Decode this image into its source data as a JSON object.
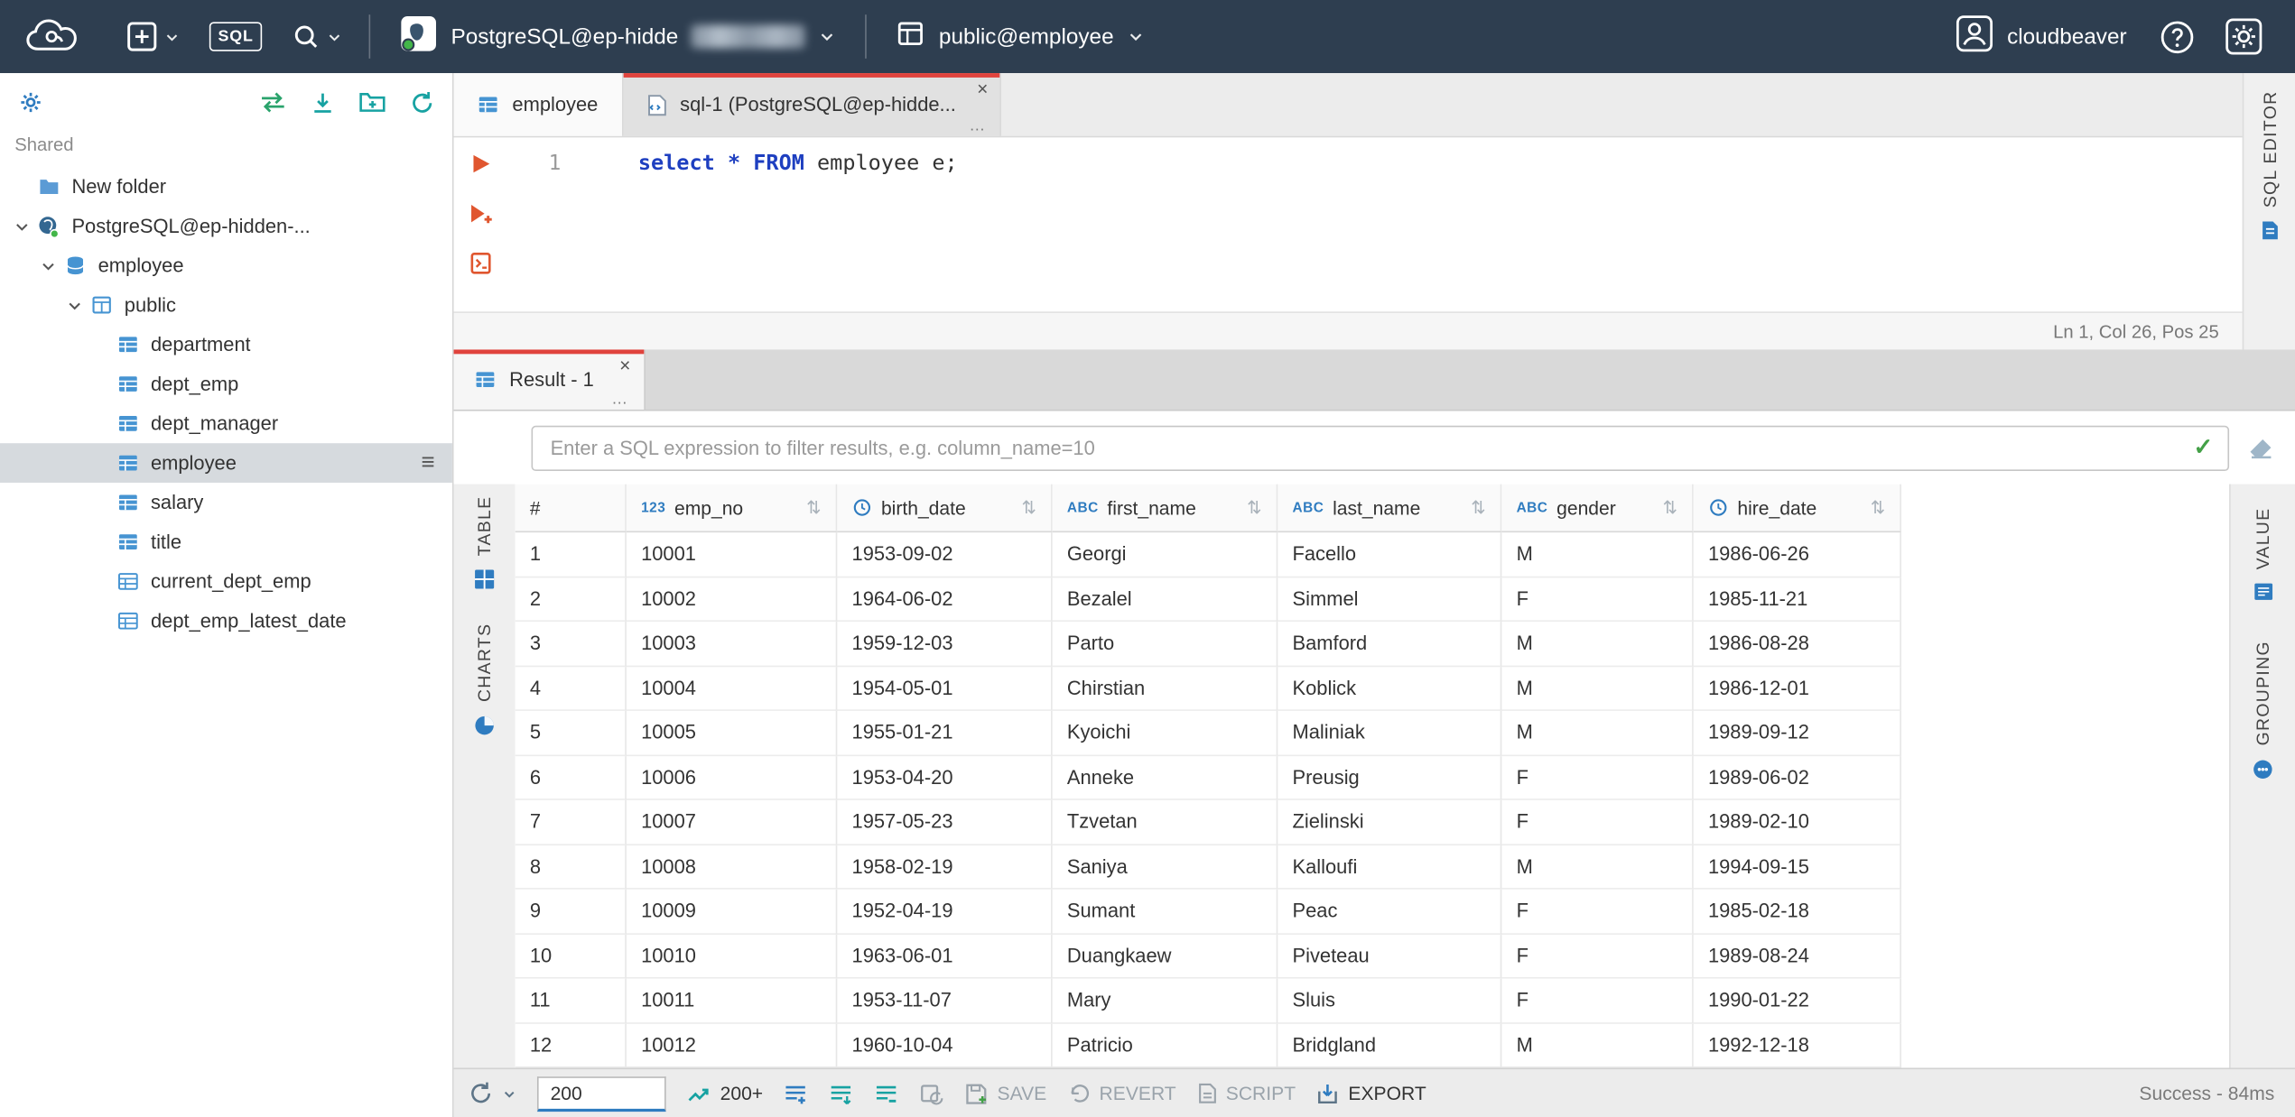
{
  "topbar": {
    "sql_badge": "SQL",
    "connection_label": "PostgreSQL@ep-hidde",
    "schema_label": "public@employee",
    "user_label": "cloudbeaver"
  },
  "sidebar": {
    "section_label": "Shared",
    "items": [
      {
        "label": "New folder",
        "icon": "folder",
        "depth": 0,
        "chevron": null
      },
      {
        "label": "PostgreSQL@ep-hidden-...",
        "icon": "postgres",
        "depth": 0,
        "chevron": "down"
      },
      {
        "label": "employee",
        "icon": "database",
        "depth": 1,
        "chevron": "down"
      },
      {
        "label": "public",
        "icon": "schema",
        "depth": 2,
        "chevron": "down"
      },
      {
        "label": "department",
        "icon": "table",
        "depth": 3,
        "chevron": null
      },
      {
        "label": "dept_emp",
        "icon": "table",
        "depth": 3,
        "chevron": null
      },
      {
        "label": "dept_manager",
        "icon": "table",
        "depth": 3,
        "chevron": null
      },
      {
        "label": "employee",
        "icon": "table",
        "depth": 3,
        "chevron": null,
        "selected": true
      },
      {
        "label": "salary",
        "icon": "table",
        "depth": 3,
        "chevron": null
      },
      {
        "label": "title",
        "icon": "table",
        "depth": 3,
        "chevron": null
      },
      {
        "label": "current_dept_emp",
        "icon": "view",
        "depth": 3,
        "chevron": null
      },
      {
        "label": "dept_emp_latest_date",
        "icon": "view",
        "depth": 3,
        "chevron": null
      }
    ]
  },
  "editor": {
    "tabs": [
      {
        "label": "employee"
      },
      {
        "label": "sql-1 (PostgreSQL@ep-hidde..."
      }
    ],
    "line_number": "1",
    "tokens": [
      {
        "text": "select",
        "type": "keyword"
      },
      {
        "text": " ",
        "type": "plain"
      },
      {
        "text": "*",
        "type": "keyword"
      },
      {
        "text": " ",
        "type": "plain"
      },
      {
        "text": "FROM",
        "type": "keyword"
      },
      {
        "text": " employee e;",
        "type": "plain"
      }
    ],
    "status": "Ln 1, Col 26, Pos 25",
    "side_tab": "SQL EDITOR"
  },
  "result": {
    "tab_label": "Result - 1",
    "filter_placeholder": "Enter a SQL expression to filter results, e.g. column_name=10",
    "left_tabs": [
      {
        "label": "TABLE"
      },
      {
        "label": "CHARTS"
      }
    ],
    "right_tabs": [
      {
        "label": "VALUE"
      },
      {
        "label": "GROUPING"
      }
    ],
    "grid": {
      "columns": [
        {
          "name": "#",
          "type": "index"
        },
        {
          "name": "emp_no",
          "type": "number"
        },
        {
          "name": "birth_date",
          "type": "datetime"
        },
        {
          "name": "first_name",
          "type": "string"
        },
        {
          "name": "last_name",
          "type": "string"
        },
        {
          "name": "gender",
          "type": "string"
        },
        {
          "name": "hire_date",
          "type": "datetime"
        }
      ],
      "rows": [
        [
          "1",
          "10001",
          "1953-09-02",
          "Georgi",
          "Facello",
          "M",
          "1986-06-26"
        ],
        [
          "2",
          "10002",
          "1964-06-02",
          "Bezalel",
          "Simmel",
          "F",
          "1985-11-21"
        ],
        [
          "3",
          "10003",
          "1959-12-03",
          "Parto",
          "Bamford",
          "M",
          "1986-08-28"
        ],
        [
          "4",
          "10004",
          "1954-05-01",
          "Chirstian",
          "Koblick",
          "M",
          "1986-12-01"
        ],
        [
          "5",
          "10005",
          "1955-01-21",
          "Kyoichi",
          "Maliniak",
          "M",
          "1989-09-12"
        ],
        [
          "6",
          "10006",
          "1953-04-20",
          "Anneke",
          "Preusig",
          "F",
          "1989-06-02"
        ],
        [
          "7",
          "10007",
          "1957-05-23",
          "Tzvetan",
          "Zielinski",
          "F",
          "1989-02-10"
        ],
        [
          "8",
          "10008",
          "1958-02-19",
          "Saniya",
          "Kalloufi",
          "M",
          "1994-09-15"
        ],
        [
          "9",
          "10009",
          "1952-04-19",
          "Sumant",
          "Peac",
          "F",
          "1985-02-18"
        ],
        [
          "10",
          "10010",
          "1963-06-01",
          "Duangkaew",
          "Piveteau",
          "F",
          "1989-08-24"
        ],
        [
          "11",
          "10011",
          "1953-11-07",
          "Mary",
          "Sluis",
          "F",
          "1990-01-22"
        ],
        [
          "12",
          "10012",
          "1960-10-04",
          "Patricio",
          "Bridgland",
          "M",
          "1992-12-18"
        ]
      ]
    },
    "statusbar": {
      "row_limit": "200",
      "fetch_more": "200+",
      "save": "SAVE",
      "revert": "REVERT",
      "script": "SCRIPT",
      "export": "EXPORT",
      "status": "Success - 84ms"
    }
  }
}
